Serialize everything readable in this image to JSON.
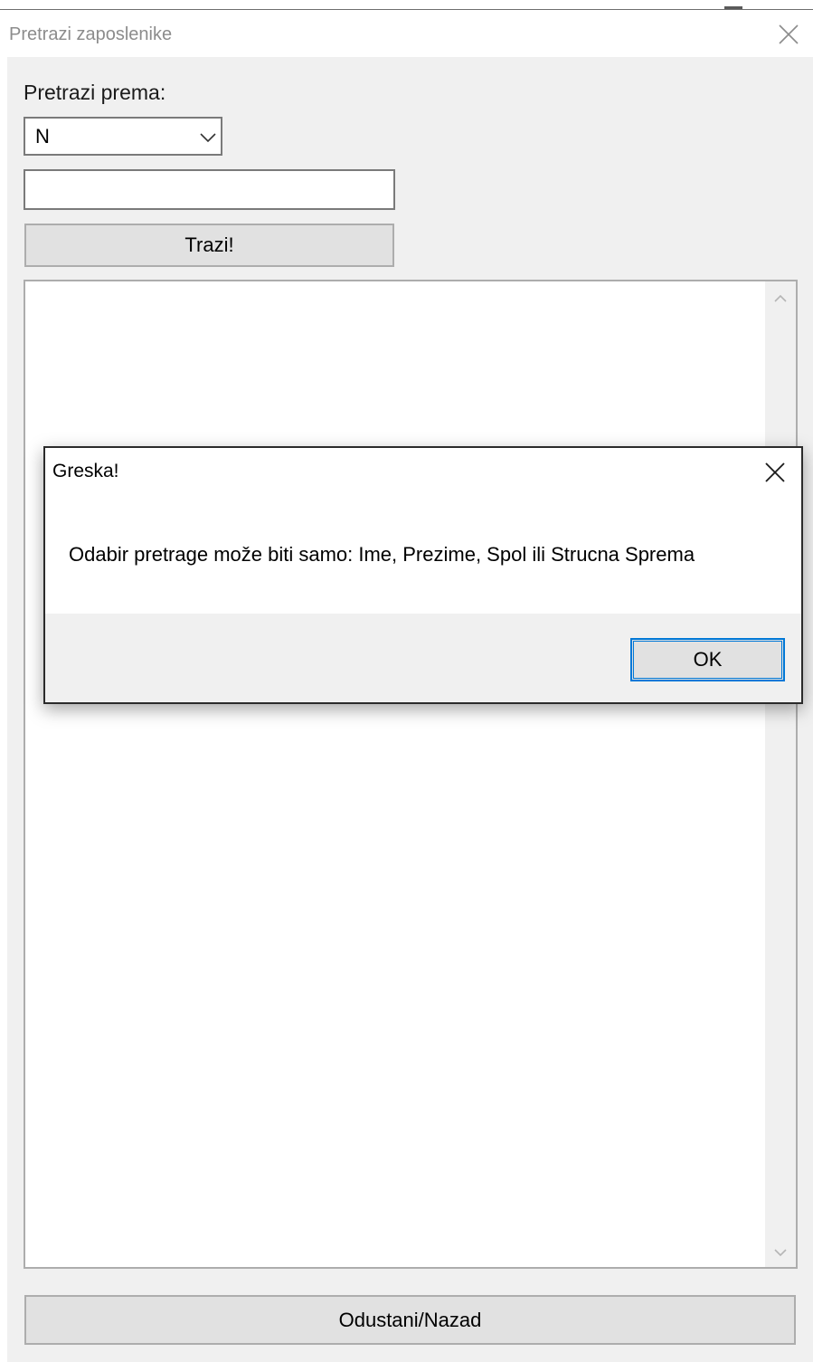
{
  "window": {
    "title": "Pretrazi zaposlenike",
    "close_icon": "close-icon"
  },
  "form": {
    "search_by_label": "Pretrazi prema:",
    "search_by_selected": "N",
    "search_text_value": "",
    "search_button_label": "Trazi!",
    "back_button_label": "Odustani/Nazad"
  },
  "results": {
    "items": []
  },
  "dialog": {
    "title": "Greska!",
    "message": "Odabir pretrage može biti samo: Ime, Prezime, Spol ili Strucna Sprema",
    "ok_label": "OK"
  },
  "colors": {
    "client_bg": "#f0f0f0",
    "button_bg": "#e1e1e1",
    "focus_border": "#0078d7"
  }
}
